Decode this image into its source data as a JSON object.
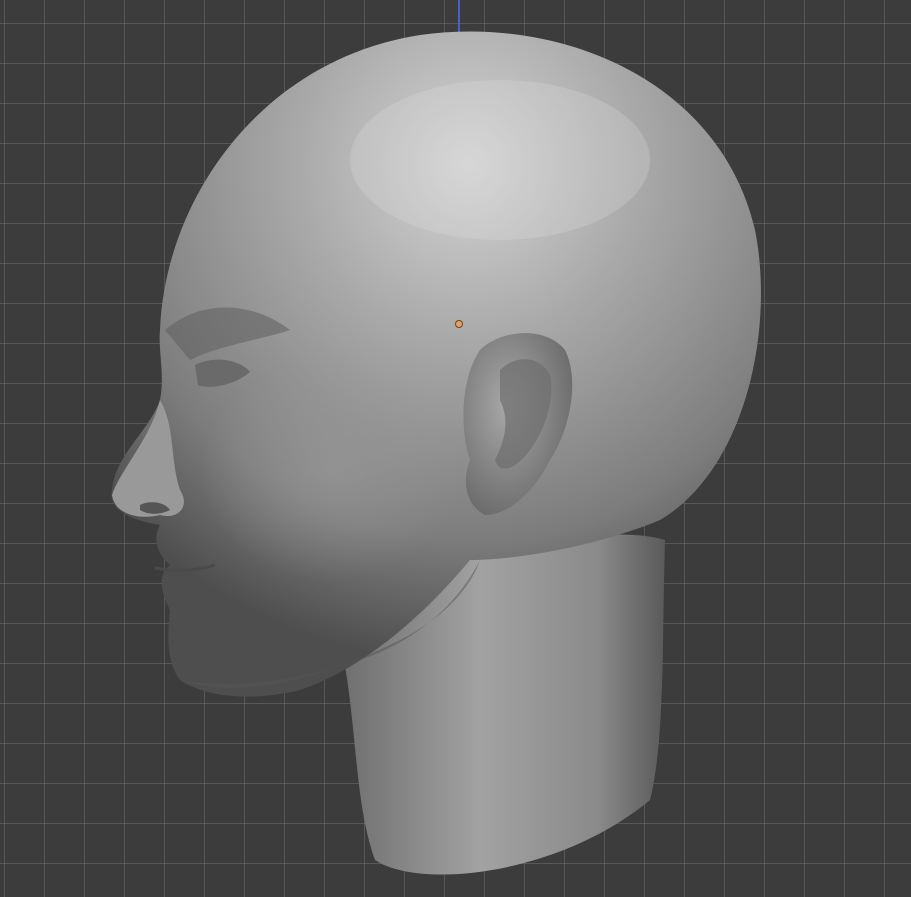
{
  "viewport": {
    "background_color": "#3c3c3c",
    "grid_color": "#6e6e6e",
    "axis_color": "#4b5fc8",
    "origin_color": "#e8a25a"
  },
  "model": {
    "icon": "sculpted-head-mesh",
    "material_color": "#8c8c8c"
  }
}
